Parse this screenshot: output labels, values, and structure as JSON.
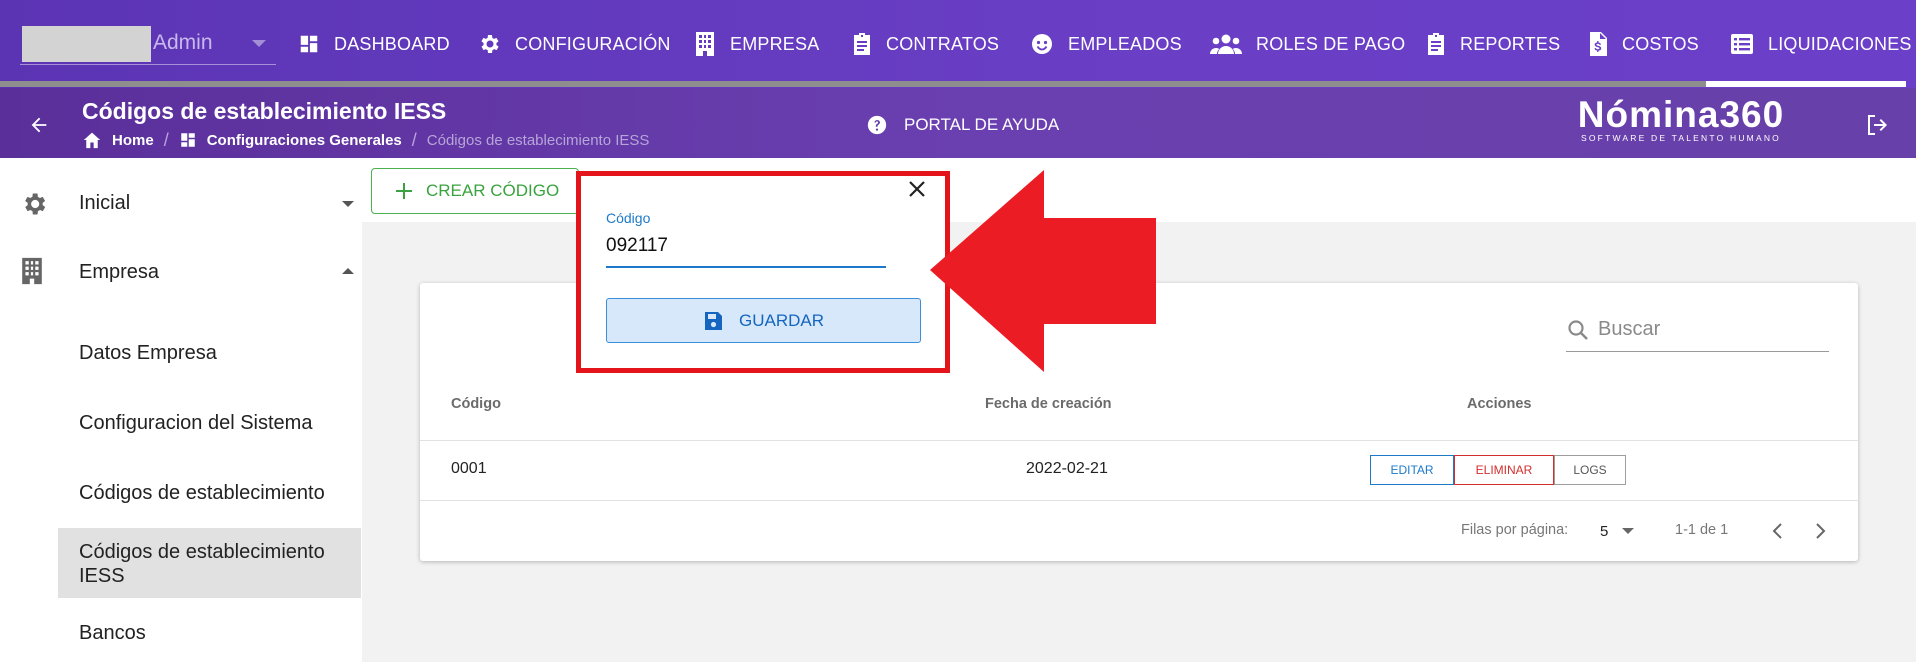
{
  "user": {
    "name": "Admin"
  },
  "nav": [
    {
      "label": "DASHBOARD",
      "icon": "dashboard-icon"
    },
    {
      "label": "CONFIGURACIÓN",
      "icon": "gear-icon"
    },
    {
      "label": "EMPRESA",
      "icon": "building-icon"
    },
    {
      "label": "CONTRATOS",
      "icon": "clipboard-icon"
    },
    {
      "label": "EMPLEADOS",
      "icon": "face-icon"
    },
    {
      "label": "ROLES DE PAGO",
      "icon": "group-icon"
    },
    {
      "label": "REPORTES",
      "icon": "clipboard-icon"
    },
    {
      "label": "COSTOS",
      "icon": "dollar-file-icon"
    },
    {
      "label": "LIQUIDACIONES",
      "icon": "list-icon"
    }
  ],
  "header": {
    "title": "Códigos de establecimiento IESS",
    "breadcrumb": [
      {
        "label": "Home",
        "icon": "home-icon"
      },
      {
        "label": "Configuraciones Generales",
        "icon": "dashboard-icon"
      },
      {
        "label": "Códigos de establecimiento IESS"
      }
    ],
    "help_label": "PORTAL DE AYUDA",
    "brand_name": "Nómina360",
    "brand_tagline": "SOFTWARE DE TALENTO HUMANO"
  },
  "sidebar": {
    "items": [
      {
        "label": "Inicial",
        "icon": "gear-icon",
        "expanded": false
      },
      {
        "label": "Empresa",
        "icon": "building-icon",
        "expanded": true
      }
    ],
    "subitems": [
      {
        "label": "Datos Empresa"
      },
      {
        "label": "Configuracion del Sistema"
      },
      {
        "label": "Códigos de establecimiento"
      },
      {
        "label": "Códigos de establecimiento IESS",
        "selected": true
      },
      {
        "label": "Bancos"
      }
    ]
  },
  "toolbar": {
    "create_label": "CREAR CÓDIGO"
  },
  "dialog": {
    "field_label": "Código",
    "field_value": "092117",
    "save_label": "GUARDAR"
  },
  "table": {
    "search_placeholder": "Buscar",
    "columns": [
      "Código",
      "Fecha de creación",
      "Acciones"
    ],
    "rows": [
      {
        "codigo": "0001",
        "fecha": "2022-02-21"
      }
    ],
    "actions": {
      "edit": "EDITAR",
      "delete": "ELIMINAR",
      "logs": "LOGS"
    },
    "footer": {
      "rows_per_page_label": "Filas por página:",
      "rows_per_page": "5",
      "range": "1-1 de 1"
    }
  },
  "colors": {
    "nav_bg": "#6a3fc6",
    "accent_red": "#ec1c24",
    "create_green": "#4caf50",
    "edit_blue": "#1e79c8",
    "delete_red": "#d32f2f"
  }
}
